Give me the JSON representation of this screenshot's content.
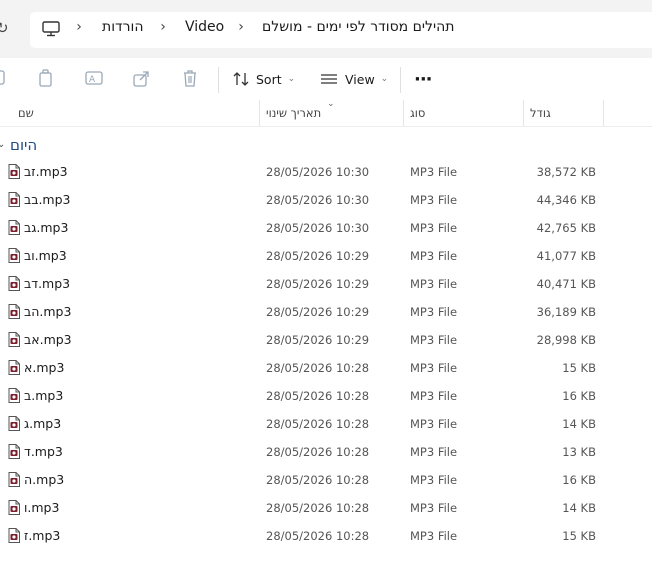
{
  "breadcrumb": {
    "items": [
      "הורדות",
      "Video",
      "תהילים מסודר לפי ימים - מושלם"
    ]
  },
  "toolbar": {
    "sort_label": "Sort",
    "view_label": "View",
    "more_label": "···",
    "icons": [
      "copy-icon",
      "paste-icon",
      "rename-icon",
      "share-icon",
      "delete-icon",
      "sort-icon",
      "view-icon"
    ]
  },
  "columns": {
    "name": "שם",
    "date": "תאריך שינוי",
    "type": "סוג",
    "size": "גודל"
  },
  "group": {
    "label": "היום"
  },
  "files": [
    {
      "name": "זב.mp3",
      "date": "28/05/2026 10:30",
      "type": "MP3 File",
      "size": "38,572 KB"
    },
    {
      "name": "בב.mp3",
      "date": "28/05/2026 10:30",
      "type": "MP3 File",
      "size": "44,346 KB"
    },
    {
      "name": "גב.mp3",
      "date": "28/05/2026 10:30",
      "type": "MP3 File",
      "size": "42,765 KB"
    },
    {
      "name": "וב.mp3",
      "date": "28/05/2026 10:29",
      "type": "MP3 File",
      "size": "41,077 KB"
    },
    {
      "name": "דב.mp3",
      "date": "28/05/2026 10:29",
      "type": "MP3 File",
      "size": "40,471 KB"
    },
    {
      "name": "הב.mp3",
      "date": "28/05/2026 10:29",
      "type": "MP3 File",
      "size": "36,189 KB"
    },
    {
      "name": "אב.mp3",
      "date": "28/05/2026 10:29",
      "type": "MP3 File",
      "size": "28,998 KB"
    },
    {
      "name": "א.mp3",
      "date": "28/05/2026 10:28",
      "type": "MP3 File",
      "size": "15 KB"
    },
    {
      "name": "ב.mp3",
      "date": "28/05/2026 10:28",
      "type": "MP3 File",
      "size": "16 KB"
    },
    {
      "name": "ג.mp3",
      "date": "28/05/2026 10:28",
      "type": "MP3 File",
      "size": "14 KB"
    },
    {
      "name": "ד.mp3",
      "date": "28/05/2026 10:28",
      "type": "MP3 File",
      "size": "13 KB"
    },
    {
      "name": "ה.mp3",
      "date": "28/05/2026 10:28",
      "type": "MP3 File",
      "size": "16 KB"
    },
    {
      "name": "ו.mp3",
      "date": "28/05/2026 10:28",
      "type": "MP3 File",
      "size": "14 KB"
    },
    {
      "name": "ז.mp3",
      "date": "28/05/2026 10:28",
      "type": "MP3 File",
      "size": "15 KB"
    }
  ],
  "colors": {
    "group_label": "#1e4a8a",
    "toolbar_background": "#f3f3f3",
    "disabled_icon": "#9aa7b8"
  }
}
